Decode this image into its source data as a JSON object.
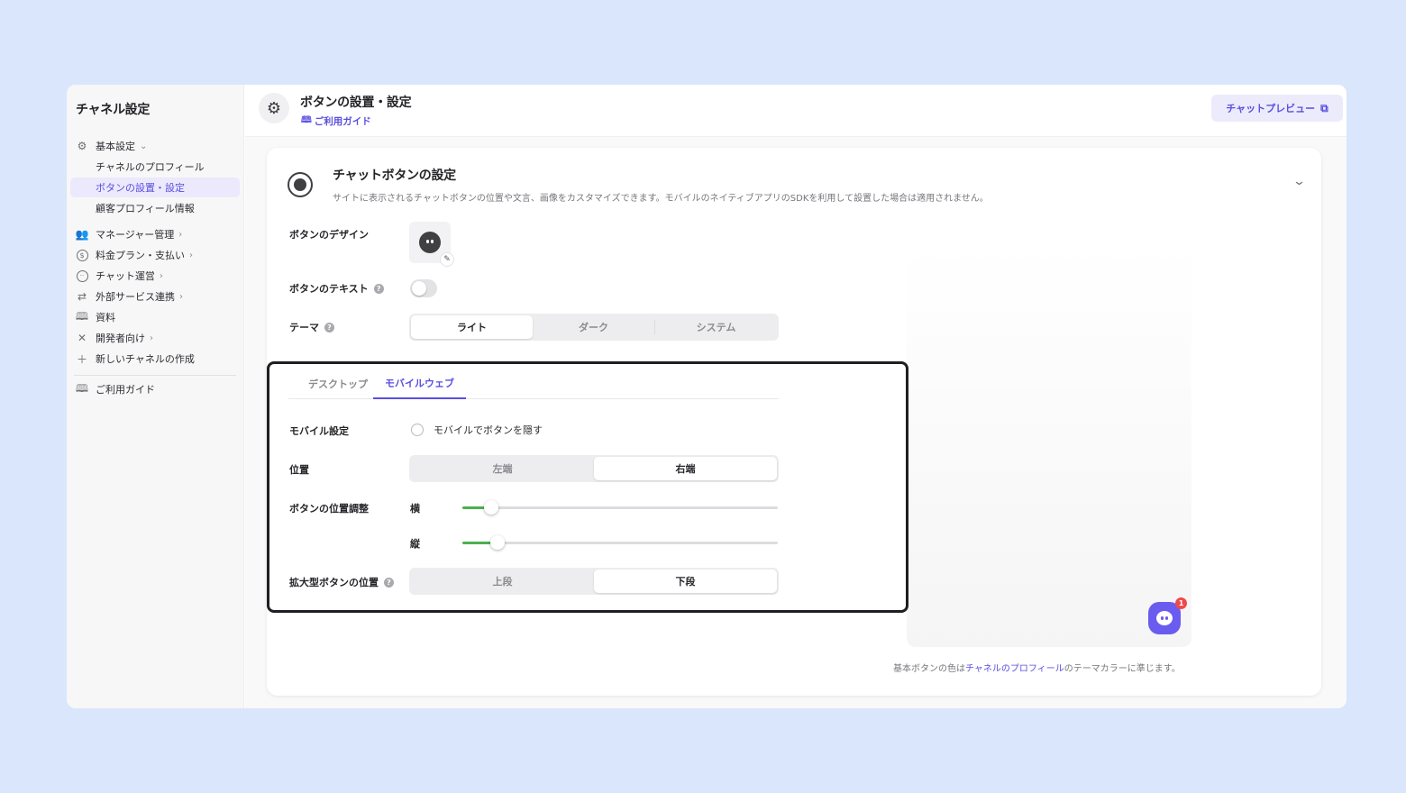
{
  "sidebar": {
    "title": "チャネル設定",
    "basic": {
      "label": "基本設定",
      "icon": "gear-icon"
    },
    "sub_items": [
      {
        "label": "チャネルのプロフィール"
      },
      {
        "label": "ボタンの設置・設定"
      },
      {
        "label": "顧客プロフィール情報"
      }
    ],
    "items": [
      {
        "label": "マネージャー管理",
        "icon": "users-icon"
      },
      {
        "label": "料金プラン・支払い",
        "icon": "dollar-icon"
      },
      {
        "label": "チャット運営",
        "icon": "chat-icon"
      },
      {
        "label": "外部サービス連携",
        "icon": "swap-icon"
      },
      {
        "label": "資料",
        "icon": "book-icon"
      },
      {
        "label": "開発者向け",
        "icon": "tools-icon"
      },
      {
        "label": "新しいチャネルの作成",
        "icon": "plus-icon"
      }
    ],
    "guide": "ご利用ガイド"
  },
  "header": {
    "title": "ボタンの設置・設定",
    "guide": "ご利用ガイド",
    "preview_button": "チャットプレビュー"
  },
  "card": {
    "title": "チャットボタンの設定",
    "description": "サイトに表示されるチャットボタンの位置や文言、画像をカスタマイズできます。モバイルのネイティブアプリのSDKを利用して設置した場合は適用されません。",
    "design_label": "ボタンのデザイン",
    "text_label": "ボタンのテキスト",
    "text_toggle_on": false,
    "theme_label": "テーマ",
    "theme_options": [
      "ライト",
      "ダーク",
      "システム"
    ],
    "theme_selected": "ライト",
    "tabs": [
      "デスクトップ",
      "モバイルウェブ"
    ],
    "active_tab": "モバイルウェブ",
    "mobile_setting_label": "モバイル設定",
    "hide_on_mobile_label": "モバイルでボタンを隠す",
    "hide_on_mobile_checked": false,
    "position_label": "位置",
    "position_options": [
      "左端",
      "右端"
    ],
    "position_selected": "右端",
    "offset_label": "ボタンの位置調整",
    "horizontal_label": "横",
    "horizontal_value": 0.09,
    "vertical_label": "縦",
    "vertical_value": 0.11,
    "expanded_label": "拡大型ボタンの位置",
    "expanded_options": [
      "上段",
      "下段"
    ],
    "expanded_selected": "下段",
    "badge_count": "1",
    "note_prefix": "基本ボタンの色は",
    "note_link": "チャネルのプロフィール",
    "note_suffix": "のテーマカラーに準じます。"
  },
  "colors": {
    "accent": "#5a4ee0",
    "slider_fill": "#4caf50",
    "badge": "#ef4a4a",
    "page_bg": "#d9e6fb"
  }
}
